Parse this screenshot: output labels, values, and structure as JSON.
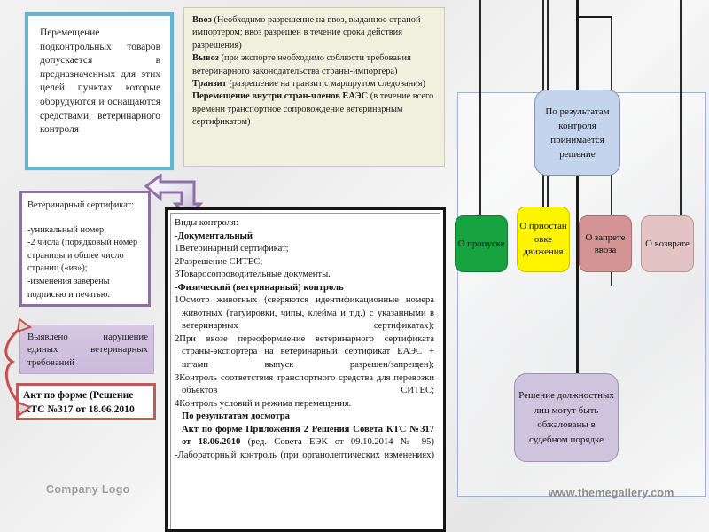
{
  "slide": {
    "background_color": "#f0f0f0"
  },
  "movement_box": {
    "text": "Перемещение подконтрольных товаров допускается в предназначенных для этих целей пунктах которые оборудуются и оснащаются средствами ветеринарного контроля",
    "border_color": "#64b5cd"
  },
  "regimes_box": {
    "background_color": "#eff1de",
    "items": [
      {
        "term": "Ввоз",
        "detail": " (Необходимо разрешение на ввоз, выданное страной импортером; ввоз разрешен в течение срока действия разрешения)"
      },
      {
        "term": "Вывоз",
        "detail": " (при экспорте необходимо соблюсти требования ветеринарного законодательства страны-импортера)"
      },
      {
        "term": "Транзит",
        "detail": " (разрешение на транзит с маршрутом следования)"
      },
      {
        "term": "Перемещение внутри стран-членов ЕАЭС",
        "detail": " (в течение всего времени транспортное сопровождение ветеринарным сертификатом)"
      }
    ]
  },
  "certificate_box": {
    "title": "Ветеринарный сертификат:",
    "border_color": "#8e6fa8",
    "lines": [
      "-уникальный номер;",
      "-2 числа (порядковый номер страницы и общее число страниц («из»);",
      "-изменения заверены подписью и печатью."
    ]
  },
  "violation_box": {
    "text": "Выявлено нарушение единых ветеринарных требований",
    "background_color": "#cbbadc"
  },
  "act_box": {
    "text": "Акт по форме (Решение КТС №317 от 18.06.2010",
    "border_color": "#c05a5a"
  },
  "controls_box": {
    "heading": "Виды контроля:",
    "section1_title": "Документальный",
    "section1_items": [
      "1Ветеринарный сертификат;",
      "2Разрешение СИТЕС;",
      "3Товаросопроводительные документы."
    ],
    "section2_title": "Физический (ветеринарный) контроль",
    "section2_items": [
      "1Осмотр животных (сверяются идентификационные номера животных (татуировки, чипы, клейма и т.д.) с указанными в ветеринарных сертификатах);",
      "2При ввозе переоформление ветеринарного сертификата страны-экспортера на ветеринарный сертификат ЕАЭС + штамп выпуск разрешен/запрещен);",
      "3Контроль соответствия транспортного средства для перевозки объектов СИТЕС;",
      "4Контроль условий и режима перемещения."
    ],
    "inspection_title": "По результатам досмотра",
    "act_bold": "Акт по форме   Приложения 2 Решения Совета КТС  №317  от  18.06.2010",
    "act_rest": " (ред. Совета ЕЭК от 09.10.2014 № 95)",
    "lab_item": "-Лабораторный контроль (при органолептических изменениях)"
  },
  "decision_panel": {
    "result_box": {
      "text": "По результатам контроля принимается решение",
      "color": "#c3d4ec"
    },
    "outcomes": [
      {
        "label": "О пропуске",
        "color": "#16a340"
      },
      {
        "label": "О приостан овке движения",
        "color": "#fdf500"
      },
      {
        "label": "О запрете ввоза",
        "color": "#d49496"
      },
      {
        "label": "О возврате",
        "color": "#e3c3c4"
      }
    ],
    "appeal_box": {
      "text": "Решение должностных лиц могут быть обжалованы в судебном порядке",
      "color": "#cfc4de"
    }
  },
  "footer": {
    "company_logo": "Company Logo",
    "site_url": "www.themegallery.com"
  }
}
